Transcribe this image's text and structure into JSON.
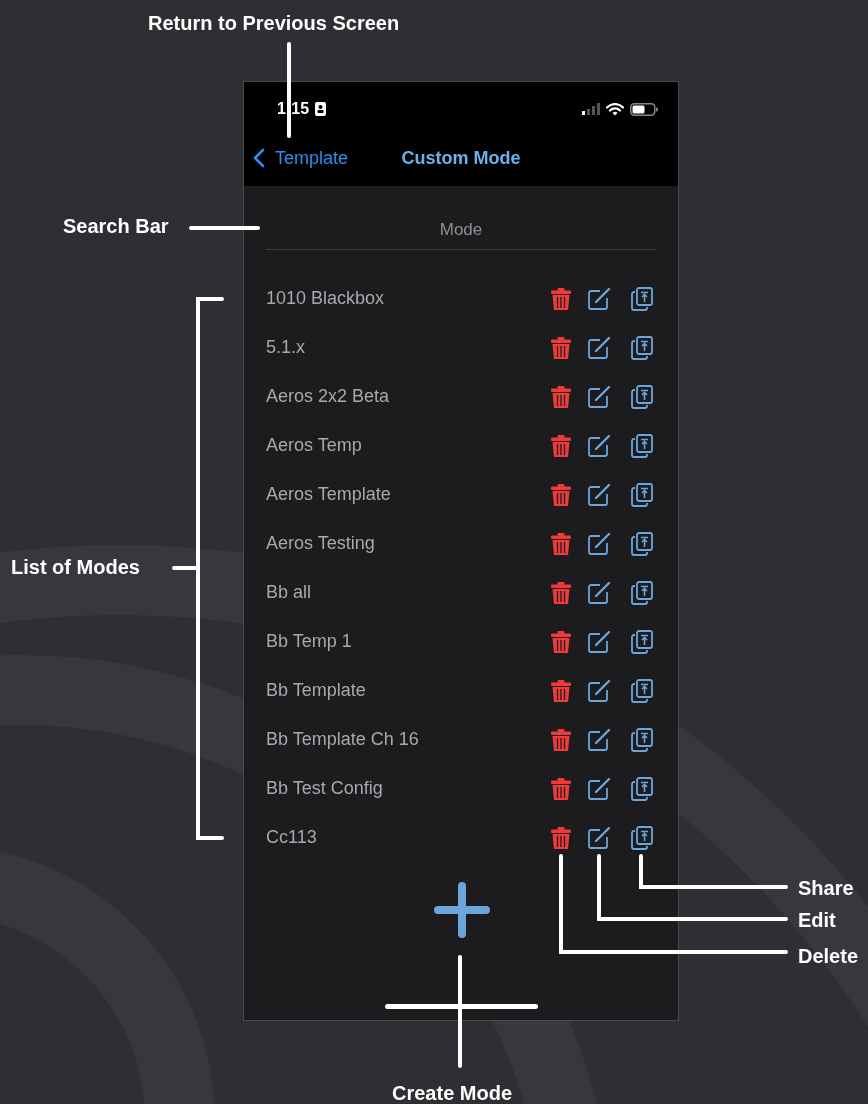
{
  "status_bar": {
    "time": "1:15"
  },
  "nav_bar": {
    "back_label": "Template",
    "title": "Custom Mode"
  },
  "search": {
    "placeholder": "Mode"
  },
  "modes": [
    {
      "name": "1010 Blackbox"
    },
    {
      "name": "5.1.x"
    },
    {
      "name": "Aeros 2x2 Beta"
    },
    {
      "name": "Aeros Temp"
    },
    {
      "name": "Aeros Template"
    },
    {
      "name": "Aeros Testing"
    },
    {
      "name": "Bb all"
    },
    {
      "name": "Bb Temp 1"
    },
    {
      "name": "Bb Template"
    },
    {
      "name": "Bb Template Ch 16"
    },
    {
      "name": "Bb Test Config"
    },
    {
      "name": "Cc113"
    }
  ],
  "annotations": [
    {
      "label": "Return to Previous Screen"
    },
    {
      "label": "Search Bar"
    },
    {
      "label": "List of Modes"
    },
    {
      "label": "Share"
    },
    {
      "label": "Edit"
    },
    {
      "label": "Delete"
    },
    {
      "label": "Create Mode"
    }
  ]
}
